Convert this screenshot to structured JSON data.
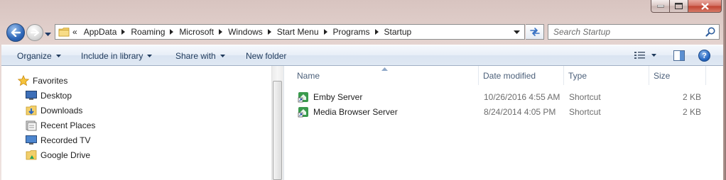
{
  "window": {
    "caption_buttons": [
      "minimize",
      "maximize",
      "close"
    ]
  },
  "address_bar": {
    "overflow_indicator": "«",
    "breadcrumbs": [
      "AppData",
      "Roaming",
      "Microsoft",
      "Windows",
      "Start Menu",
      "Programs",
      "Startup"
    ]
  },
  "search": {
    "placeholder": "Search Startup"
  },
  "command_bar": {
    "organize": "Organize",
    "include_in_library": "Include in library",
    "share_with": "Share with",
    "new_folder": "New folder",
    "help": "?"
  },
  "navigation_pane": {
    "favorites_label": "Favorites",
    "items": [
      {
        "label": "Desktop",
        "icon": "desktop-icon"
      },
      {
        "label": "Downloads",
        "icon": "downloads-icon"
      },
      {
        "label": "Recent Places",
        "icon": "recent-places-icon"
      },
      {
        "label": "Recorded TV",
        "icon": "recorded-tv-icon"
      },
      {
        "label": "Google Drive",
        "icon": "google-drive-icon"
      }
    ]
  },
  "file_list": {
    "columns": {
      "name": "Name",
      "date_modified": "Date modified",
      "type": "Type",
      "size": "Size"
    },
    "rows": [
      {
        "name": "Emby Server",
        "date_modified": "10/26/2016 4:55 AM",
        "type": "Shortcut",
        "size": "2 KB"
      },
      {
        "name": "Media Browser Server",
        "date_modified": "8/24/2014 4:05 PM",
        "type": "Shortcut",
        "size": "2 KB"
      }
    ]
  },
  "colors": {
    "command_text": "#1e395b",
    "column_header_text": "#4c607a",
    "secondary_text": "#6d6d6d",
    "close_button": "#c0412f"
  }
}
